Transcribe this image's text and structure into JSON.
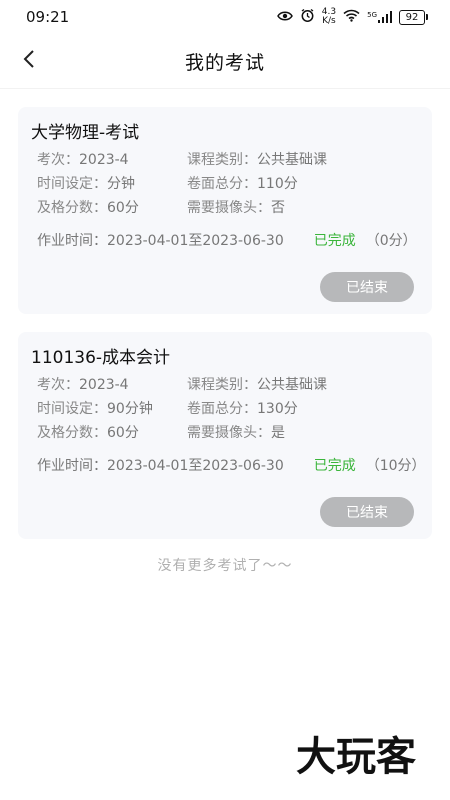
{
  "status_bar": {
    "time": "09:21",
    "net_speed_value": "4.3",
    "net_speed_unit": "K/s",
    "signal_label": "5G",
    "battery": "92"
  },
  "header": {
    "title": "我的考试"
  },
  "exams": [
    {
      "title": "大学物理-考试",
      "session_label": "考次：",
      "session": "2023-4",
      "category_label": "课程类别：",
      "category": "公共基础课",
      "time_label": "时间设定：",
      "time_setting": "分钟",
      "total_label": "卷面总分：",
      "total_score": "110分",
      "pass_label": "及格分数：",
      "pass_score": "60分",
      "camera_label": "需要摄像头：",
      "camera": "否",
      "work_time_label": "作业时间：",
      "work_time": "2023-04-01至2023-06-30",
      "status": "已完成",
      "score": "（0分）",
      "button_label": "已结束"
    },
    {
      "title": "110136-成本会计",
      "session_label": "考次：",
      "session": "2023-4",
      "category_label": "课程类别：",
      "category": "公共基础课",
      "time_label": "时间设定：",
      "time_setting": "90分钟",
      "total_label": "卷面总分：",
      "total_score": "130分",
      "pass_label": "及格分数：",
      "pass_score": "60分",
      "camera_label": "需要摄像头：",
      "camera": "是",
      "work_time_label": "作业时间：",
      "work_time": "2023-04-01至2023-06-30",
      "status": "已完成",
      "score": "（10分）",
      "button_label": "已结束"
    }
  ],
  "footer": {
    "no_more": "没有更多考试了～～"
  },
  "watermark": {
    "text": "大玩客"
  },
  "colors": {
    "status_done": "#3bb53b",
    "end_button": "#b7b8ba",
    "card_bg": "#f7f8fb"
  },
  "icons": {
    "back": "chevron-left-icon",
    "eye": "eye-icon",
    "alarm": "alarm-icon",
    "wifi": "wifi-icon",
    "signal": "signal-icon",
    "battery": "battery-icon"
  }
}
